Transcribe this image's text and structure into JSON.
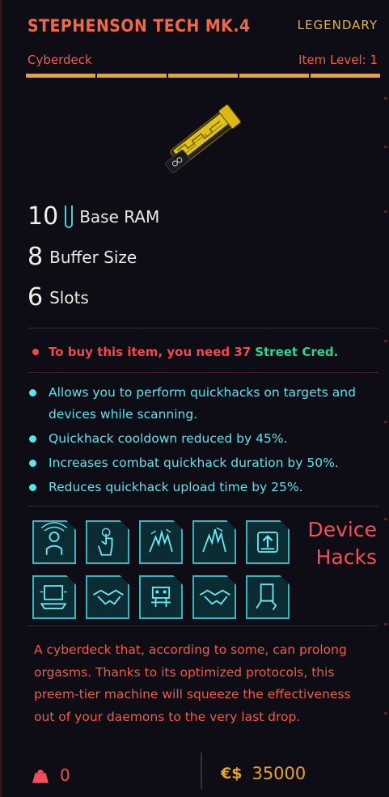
{
  "item": {
    "name": "STEPHENSON TECH MK.4",
    "rarity": "LEGENDARY",
    "type": "Cyberdeck",
    "item_level": "Item Level: 1"
  },
  "stats": [
    {
      "value": "10",
      "label": "Base RAM",
      "icon": "ram-icon"
    },
    {
      "value": "8",
      "label": "Buffer Size"
    },
    {
      "value": "6",
      "label": "Slots"
    }
  ],
  "requirement": {
    "text": "To buy this item, you need 37",
    "highlight": "Street Cred."
  },
  "effects": [
    "Allows you to perform quickhacks on targets and devices while scanning.",
    "Quickhack cooldown reduced by 45%.",
    "Increases combat quickhack duration by 50%.",
    "Reduces quickhack upload time by 25%."
  ],
  "device_hacks": {
    "title": "Device Hacks",
    "icons": [
      "person-signal-icon",
      "finger-tap-icon",
      "hand-wave-icon",
      "hand-wave-icon",
      "upload-icon",
      "computer-icon",
      "handshake-icon",
      "robot-icon",
      "handshake-icon",
      "hand-card-icon"
    ]
  },
  "description": "A cyberdeck that, according to some, can prolong orgasms. Thanks to its optimized protocols, this preem-tier machine will squeeze the effectiveness out of your daemons to the very last drop.",
  "footer": {
    "weight": "0",
    "currency": "€$",
    "price": "35000"
  },
  "colors": {
    "title": "#f06848",
    "legendary": "#e2b24a",
    "accent_red": "#f0505a",
    "cyan": "#5ee3ec",
    "green": "#2fd58a",
    "gold": "#e8a236"
  }
}
